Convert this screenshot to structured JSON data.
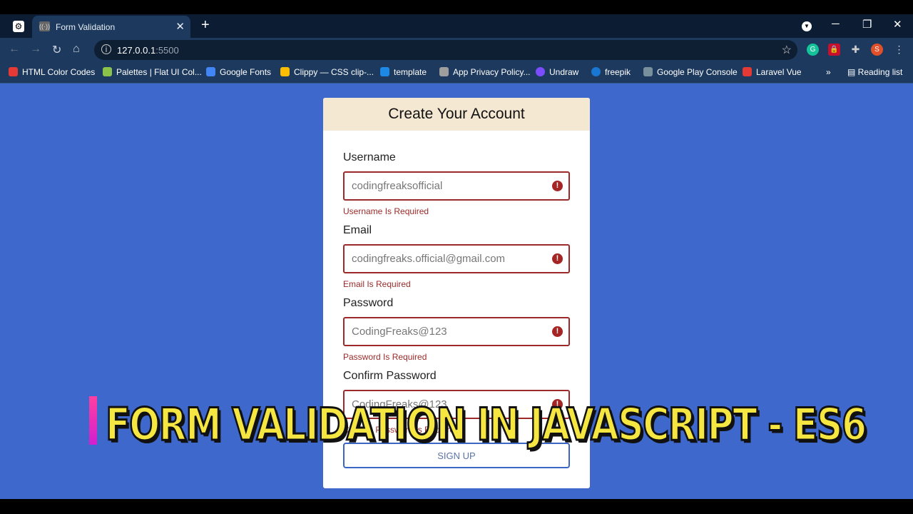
{
  "browser": {
    "tab_title": "Form Validation",
    "url_host": "127.0.0.1",
    "url_port": ":5500",
    "bookmarks": [
      {
        "label": "HTML Color Codes",
        "color": "#e53935"
      },
      {
        "label": "Palettes | Flat UI Col...",
        "color": "#8bc34a"
      },
      {
        "label": "Google Fonts",
        "color": "#4285f4"
      },
      {
        "label": "Clippy — CSS clip-...",
        "color": "#fbbc04"
      },
      {
        "label": "template",
        "color": "#1e88e5"
      },
      {
        "label": "App Privacy Policy...",
        "color": "#9e9e9e"
      },
      {
        "label": "Undraw",
        "color": "#7c4dff"
      },
      {
        "label": "freepik",
        "color": "#1976d2"
      },
      {
        "label": "Google Play Console",
        "color": "#78909c"
      },
      {
        "label": "Laravel Vue",
        "color": "#e53935"
      }
    ],
    "reading_list": "Reading list",
    "profile_initial": "S",
    "grammarly": "G"
  },
  "form": {
    "title": "Create Your Account",
    "fields": [
      {
        "label": "Username",
        "value": "codingfreaksofficial",
        "error": "Username Is Required"
      },
      {
        "label": "Email",
        "value": "codingfreaks.official@gmail.com",
        "error": "Email Is Required"
      },
      {
        "label": "Password",
        "value": "CodingFreaks@123",
        "error": "Password Is Required"
      },
      {
        "label": "Confirm Password",
        "value": "CodingFreaks@123",
        "error": "Confirm Password Is Required"
      }
    ],
    "submit": "SIGN UP",
    "error_color": "#9c2a2a",
    "accent": "#3a66c4"
  },
  "overlay_title": "FORM VALIDATION IN JAVASCRIPT - ES6"
}
